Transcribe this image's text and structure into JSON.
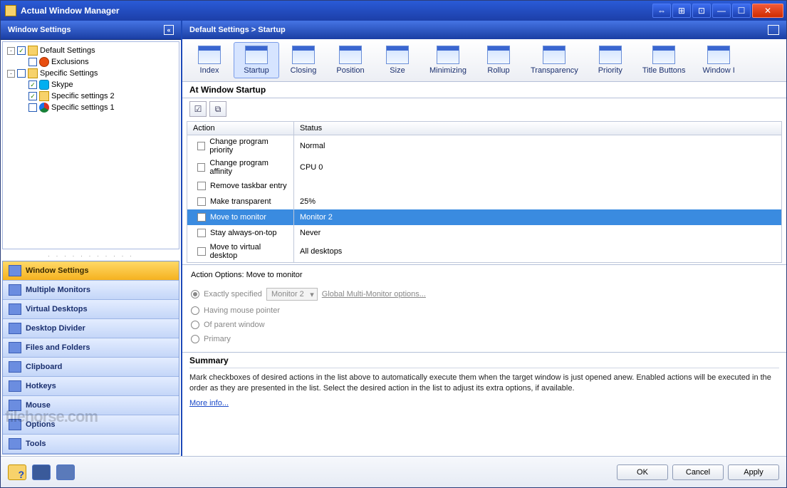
{
  "window_title": "Actual Window Manager",
  "titlebar_buttons": [
    "⇔",
    "⊞",
    "⊡",
    "—",
    "☐",
    "✕"
  ],
  "sidebar": {
    "header": "Window Settings",
    "tree": [
      {
        "expand": "-",
        "checked": true,
        "icon": "folder",
        "label": "Default Settings",
        "indent": 0
      },
      {
        "expand": "",
        "checked": false,
        "icon": "excl",
        "label": "Exclusions",
        "indent": 1
      },
      {
        "expand": "-",
        "checked": false,
        "icon": "folder",
        "label": "Specific Settings",
        "indent": 0
      },
      {
        "expand": "",
        "checked": true,
        "icon": "skype",
        "label": "Skype",
        "indent": 1
      },
      {
        "expand": "",
        "checked": true,
        "icon": "folder",
        "label": "Specific settings 2",
        "indent": 1
      },
      {
        "expand": "",
        "checked": false,
        "icon": "chrome",
        "label": "Specific settings 1",
        "indent": 1
      }
    ],
    "categories": [
      {
        "label": "Window Settings",
        "active": true
      },
      {
        "label": "Multiple Monitors",
        "active": false
      },
      {
        "label": "Virtual Desktops",
        "active": false
      },
      {
        "label": "Desktop Divider",
        "active": false
      },
      {
        "label": "Files and Folders",
        "active": false
      },
      {
        "label": "Clipboard",
        "active": false
      },
      {
        "label": "Hotkeys",
        "active": false
      },
      {
        "label": "Mouse",
        "active": false
      },
      {
        "label": "Options",
        "active": false
      },
      {
        "label": "Tools",
        "active": false
      }
    ]
  },
  "main": {
    "breadcrumb": "Default Settings > Startup",
    "toolbar": [
      {
        "label": "Index",
        "active": false
      },
      {
        "label": "Startup",
        "active": true
      },
      {
        "label": "Closing",
        "active": false
      },
      {
        "label": "Position",
        "active": false
      },
      {
        "label": "Size",
        "active": false
      },
      {
        "label": "Minimizing",
        "active": false
      },
      {
        "label": "Rollup",
        "active": false
      },
      {
        "label": "Transparency",
        "active": false
      },
      {
        "label": "Priority",
        "active": false
      },
      {
        "label": "Title Buttons",
        "active": false
      },
      {
        "label": "Window I",
        "active": false
      }
    ],
    "section_title": "At Window Startup",
    "grid": {
      "headers": {
        "action": "Action",
        "status": "Status"
      },
      "rows": [
        {
          "action": "Change program priority",
          "status": "Normal",
          "selected": false
        },
        {
          "action": "Change program affinity",
          "status": "CPU 0",
          "selected": false
        },
        {
          "action": "Remove taskbar entry",
          "status": "",
          "selected": false
        },
        {
          "action": "Make transparent",
          "status": "25%",
          "selected": false
        },
        {
          "action": "Move to monitor",
          "status": "Monitor 2",
          "selected": true
        },
        {
          "action": "Stay always-on-top",
          "status": "Never",
          "selected": false
        },
        {
          "action": "Move to virtual desktop",
          "status": "All desktops",
          "selected": false
        }
      ]
    },
    "options": {
      "title": "Action Options: Move to monitor",
      "exactly_specified": "Exactly specified",
      "monitor_select": "Monitor 2",
      "global_link": "Global Multi-Monitor options...",
      "having_mouse": "Having mouse pointer",
      "of_parent": "Of parent window",
      "primary": "Primary"
    },
    "summary": {
      "heading": "Summary",
      "text": "Mark checkboxes of desired actions in the list above to automatically execute them when the target window is just opened anew. Enabled actions will be executed in the order as they are presented in the list. Select the desired action in the list to adjust its extra options, if available.",
      "more": "More info..."
    }
  },
  "footer": {
    "ok": "OK",
    "cancel": "Cancel",
    "apply": "Apply"
  },
  "watermark": "filehorse.com"
}
